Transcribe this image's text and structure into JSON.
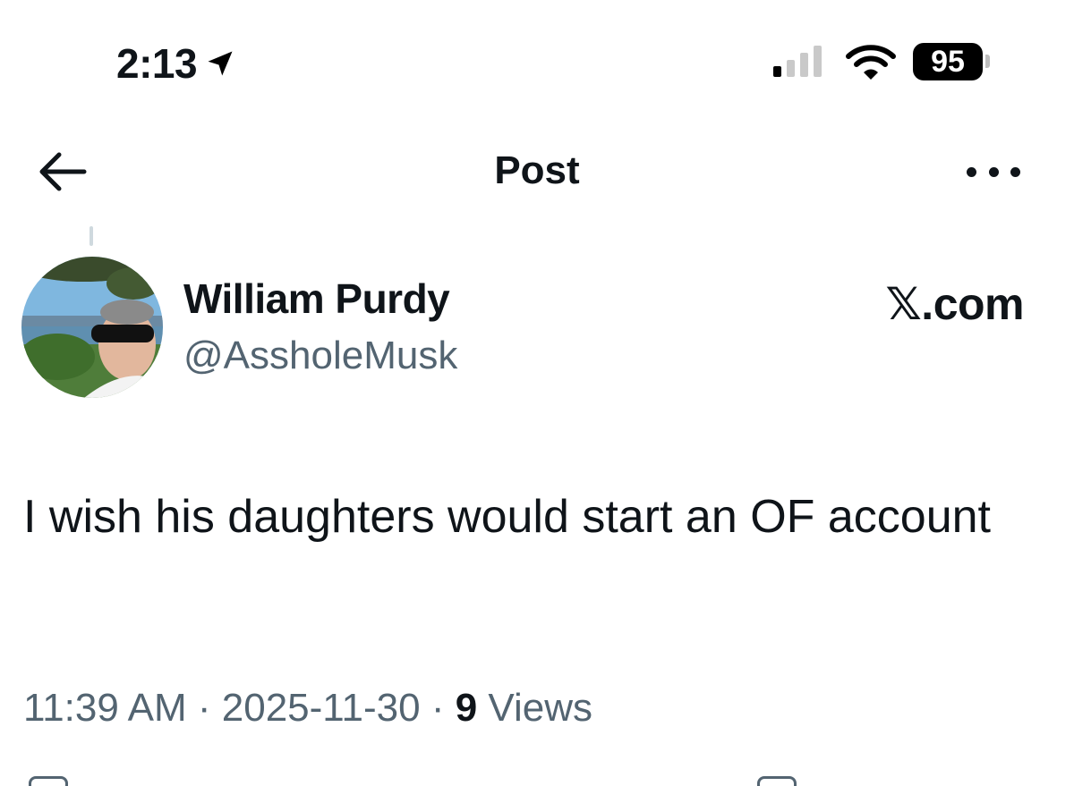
{
  "status_bar": {
    "time": "2:13",
    "battery_level": "95",
    "signal_bars_active": 1,
    "signal_bars_total": 4,
    "icons": [
      "location-arrow-icon",
      "signal-icon",
      "wifi-icon",
      "battery-icon"
    ]
  },
  "header": {
    "title": "Post",
    "icons": [
      "back-arrow-icon",
      "more-options-icon"
    ]
  },
  "post": {
    "author_name": "William Purdy",
    "author_handle": "@AssholeMusk",
    "source_label": "𝕏.com",
    "text": "I wish his daughters would start an OF account",
    "timestamp_time": "11:39 AM",
    "separator": "·",
    "timestamp_date": "2025-11-30",
    "views_count": "9",
    "views_label": "Views"
  },
  "colors": {
    "text_primary": "#0f1419",
    "text_secondary": "#536471",
    "background": "#ffffff"
  }
}
